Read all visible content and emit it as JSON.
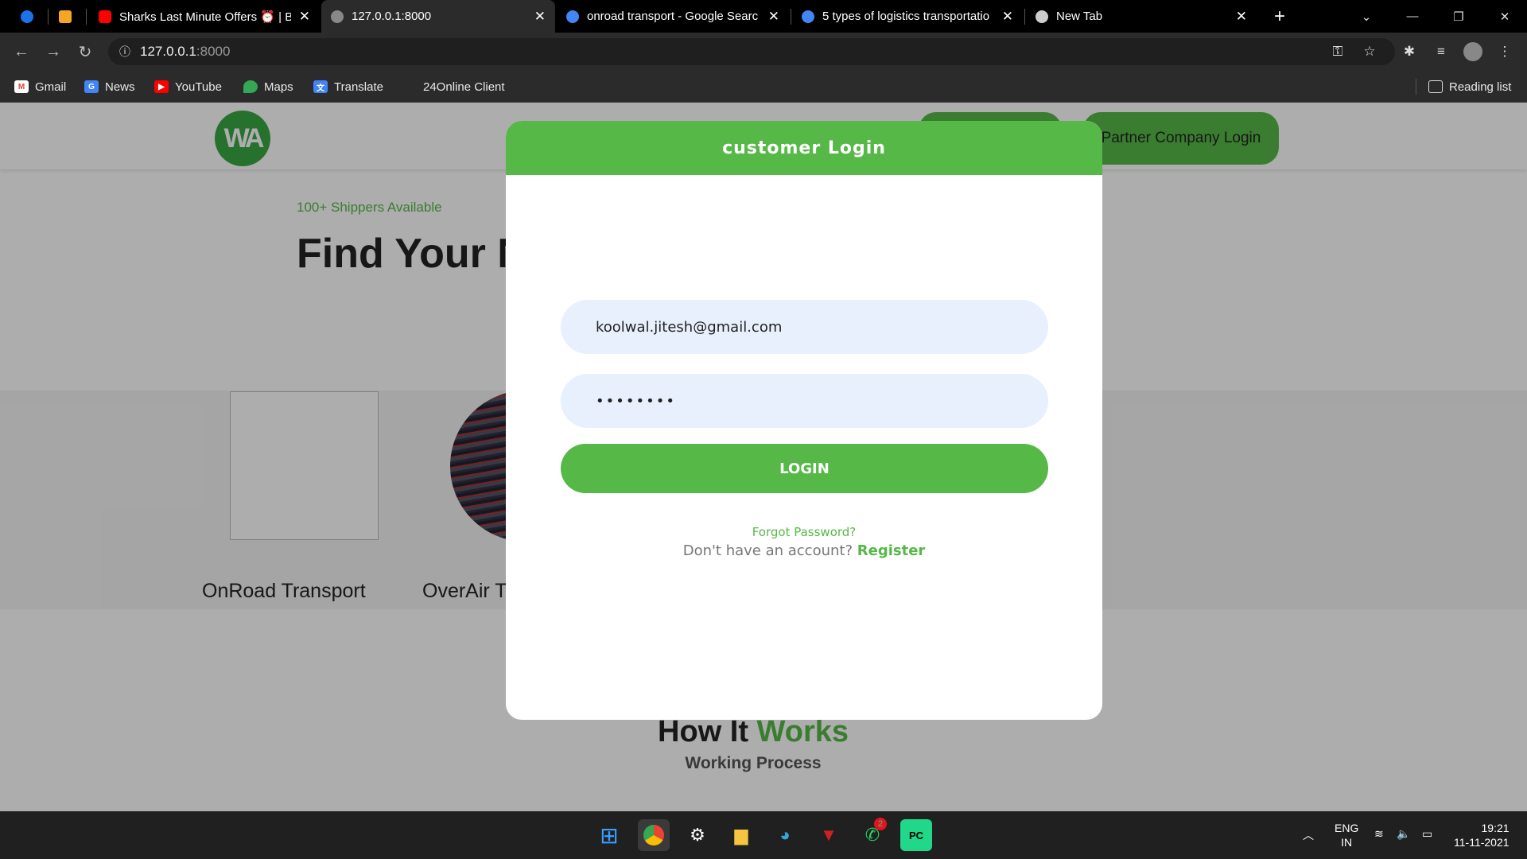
{
  "browser": {
    "tabs": [
      {
        "title": "",
        "favicon": "media-play-icon",
        "color": "#1a73e8"
      },
      {
        "title": "",
        "favicon": "notes-icon",
        "color": "#f5a623"
      },
      {
        "title": "Sharks Last Minute Offers ⏰ | B",
        "favicon": "youtube-icon",
        "color": "#ff0000"
      },
      {
        "title": "127.0.0.1:8000",
        "favicon": "globe-icon",
        "color": "#888888"
      },
      {
        "title": "onroad transport - Google Searc",
        "favicon": "google-icon",
        "color": "#4285f4"
      },
      {
        "title": "5 types of logistics transportatio",
        "favicon": "google-icon",
        "color": "#4285f4"
      },
      {
        "title": "New Tab",
        "favicon": "chrome-icon",
        "color": "#cccccc"
      }
    ],
    "url_host": "127.0.0.1",
    "url_port": ":8000",
    "bookmarks": [
      "Gmail",
      "News",
      "YouTube",
      "Maps",
      "Translate",
      "24Online Client"
    ],
    "reading_list": "Reading list"
  },
  "page": {
    "partner_login": "Partner Company Login",
    "tagline": "100+ Shippers Available",
    "headline": "Find Your N",
    "services": [
      "OnRoad Transport",
      "OverAir T"
    ],
    "how_it": "How It",
    "works": "Works",
    "working_process": "Working Process"
  },
  "modal": {
    "title": "customer Login",
    "email_value": "koolwal.jitesh@gmail.com",
    "password_value": "••••••••",
    "login_label": "LOGIN",
    "forgot": "Forgot Password?",
    "no_account": "Don't have an account?",
    "register": "Register"
  },
  "taskbar": {
    "whatsapp_badge": "2",
    "lang_top": "ENG",
    "lang_bottom": "IN",
    "time": "19:21",
    "date": "11-11-2021"
  },
  "colors": {
    "accent": "#56b847",
    "input_bg": "#e8f0fe"
  }
}
